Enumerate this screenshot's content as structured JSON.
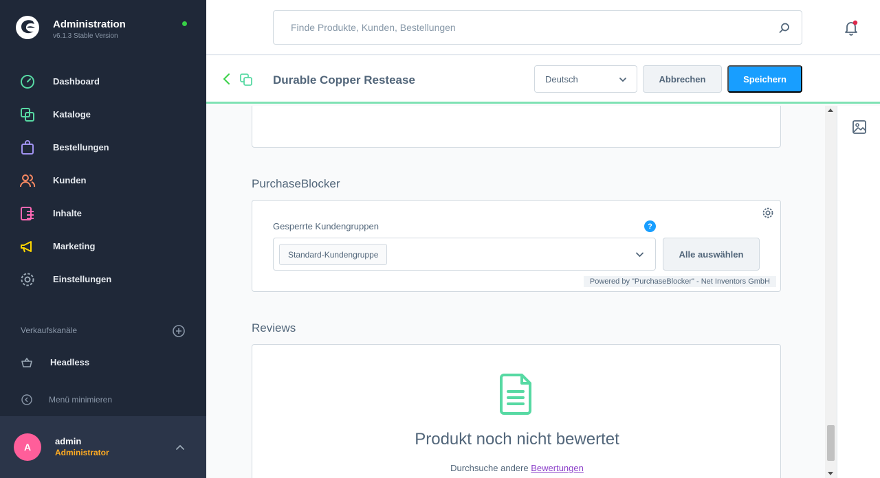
{
  "brand": {
    "title": "Administration",
    "version": "v6.1.3 Stable Version",
    "status_color": "#37d046"
  },
  "nav": [
    {
      "label": "Dashboard",
      "icon": "dashboard-icon",
      "color": "#57d9a3"
    },
    {
      "label": "Kataloge",
      "icon": "catalog-icon",
      "color": "#57d9a3"
    },
    {
      "label": "Bestellungen",
      "icon": "orders-icon",
      "color": "#a092f0"
    },
    {
      "label": "Kunden",
      "icon": "customers-icon",
      "color": "#f88962"
    },
    {
      "label": "Inhalte",
      "icon": "content-icon",
      "color": "#ff68b4"
    },
    {
      "label": "Marketing",
      "icon": "marketing-icon",
      "color": "#ffd700"
    },
    {
      "label": "Einstellungen",
      "icon": "settings-icon",
      "color": "#9aa8b5"
    }
  ],
  "sales_channels": {
    "label": "Verkaufskanäle",
    "items": [
      {
        "label": "Headless",
        "icon": "basket-icon"
      }
    ]
  },
  "minimize_label": "Menü minimieren",
  "user": {
    "initial": "A",
    "name": "admin",
    "role": "Administrator"
  },
  "search": {
    "placeholder": "Finde Produkte, Kunden, Bestellungen"
  },
  "smartbar": {
    "title": "Durable Copper Restease",
    "language": "Deutsch",
    "cancel_label": "Abbrechen",
    "save_label": "Speichern"
  },
  "purchase_blocker": {
    "title": "PurchaseBlocker",
    "field_label": "Gesperrte Kundengruppen",
    "help": "?",
    "selected_tag": "Standard-Kundengruppe",
    "select_all_label": "Alle auswählen",
    "powered_by": "Powered by \"PurchaseBlocker\" - Net Inventors GmbH"
  },
  "reviews": {
    "title": "Reviews",
    "empty_title": "Produkt noch nicht bewertet",
    "empty_sub_prefix": "Durchsuche andere",
    "empty_sub_link": "Bewertungen"
  },
  "colors": {
    "sidebar_bg": "#1f2838",
    "accent": "#189eff",
    "smartbar_border": "#7fe2b4",
    "avatar": "#ff5e9a",
    "role": "#ffab22",
    "notification_dot": "#de294c",
    "empty_icon": "#57d9a3"
  }
}
